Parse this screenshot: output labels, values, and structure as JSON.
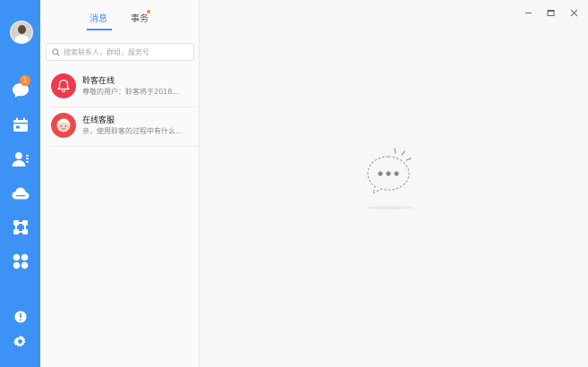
{
  "colors": {
    "accent": "#3d93f5",
    "badge": "#ff8a3d",
    "notify_red": "#ee3a4d",
    "service_red": "#e94b4b"
  },
  "rail": {
    "items": [
      {
        "name": "messages",
        "icon": "chat-bubble-icon",
        "badge": "1"
      },
      {
        "name": "calendar",
        "icon": "calendar-icon"
      },
      {
        "name": "contacts",
        "icon": "contacts-icon"
      },
      {
        "name": "cloud",
        "icon": "cloud-icon"
      },
      {
        "name": "workbench",
        "icon": "grid-nodes-icon"
      },
      {
        "name": "apps",
        "icon": "apps-icon"
      }
    ],
    "bottom": [
      {
        "name": "info",
        "icon": "info-icon"
      },
      {
        "name": "settings",
        "icon": "gear-icon"
      }
    ]
  },
  "tabs": [
    {
      "label": "消息",
      "active": true
    },
    {
      "label": "事务",
      "active": false,
      "has_dot": true
    }
  ],
  "search": {
    "placeholder": "搜索联系人，群组，服务号"
  },
  "conversations": [
    {
      "title": "聆客在线",
      "preview": "尊敬的用户：聆客将于2018...",
      "icon": "bell-icon"
    },
    {
      "title": "在线客服",
      "preview": "亲，使用聆客的过程中有什么...",
      "icon": "service-avatar-icon"
    }
  ]
}
